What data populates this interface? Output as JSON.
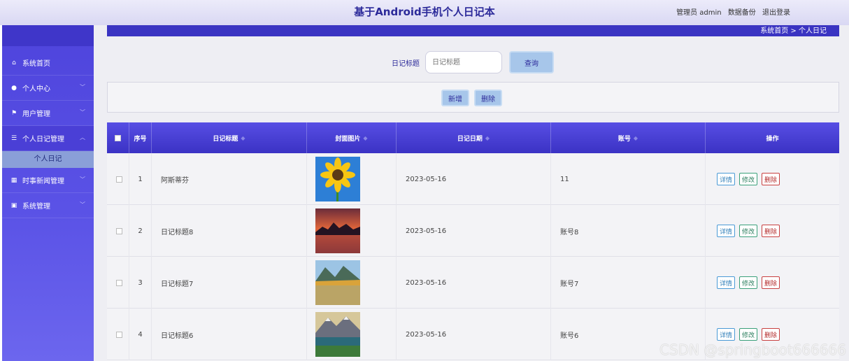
{
  "header": {
    "title": "基于Android手机个人日记本",
    "admin_label": "管理员 admin",
    "backup_link": "数据备份",
    "logout_link": "退出登录"
  },
  "sidebar": {
    "items": [
      {
        "label": "系统首页",
        "icon": "home-icon"
      },
      {
        "label": "个人中心",
        "icon": "user-icon"
      },
      {
        "label": "用户管理",
        "icon": "flag-icon"
      },
      {
        "label": "个人日记管理",
        "icon": "sliders-icon"
      },
      {
        "label": "时事新闻管理",
        "icon": "grid-icon"
      },
      {
        "label": "系统管理",
        "icon": "clipboard-icon"
      }
    ],
    "submenu": {
      "label": "个人日记"
    }
  },
  "breadcrumb": {
    "home": "系统首页",
    "separator": ">",
    "current": "个人日记"
  },
  "search": {
    "label": "日记标题",
    "placeholder": "日记标题",
    "button": "查询"
  },
  "actions": {
    "add": "新增",
    "delete": "删除"
  },
  "table": {
    "columns": {
      "index": "序号",
      "title": "日记标题",
      "cover": "封面图片",
      "date": "日记日期",
      "account": "账号",
      "ops": "操作"
    },
    "rows": [
      {
        "index": "1",
        "title": "阿斯蒂芬",
        "cover": "sunflower",
        "date": "2023-05-16",
        "account": "11"
      },
      {
        "index": "2",
        "title": "日记标题8",
        "cover": "sunset-lake",
        "date": "2023-05-16",
        "account": "账号8"
      },
      {
        "index": "3",
        "title": "日记标题7",
        "cover": "autumn-lake",
        "date": "2023-05-16",
        "account": "账号7"
      },
      {
        "index": "4",
        "title": "日记标题6",
        "cover": "mountain-lake",
        "date": "2023-05-16",
        "account": "账号6"
      }
    ],
    "op_labels": {
      "detail": "详情",
      "edit": "修改",
      "delete": "删除"
    }
  },
  "watermark": "CSDN @springboot666666",
  "colors": {
    "brand": "#3a34c2",
    "sidebar": "#5a52e6",
    "button": "#a7c6ea",
    "detail": "#4a9ad6",
    "edit": "#3aa07a",
    "delete": "#c84040"
  }
}
